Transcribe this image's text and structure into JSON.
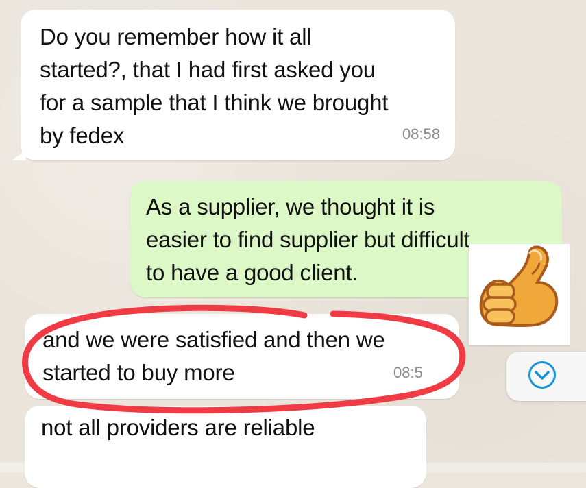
{
  "conversation": {
    "messages": [
      {
        "text": "Do you remember how it all\nstarted?, that I had first asked you\nfor a sample that I think we brought\nby fedex",
        "time": "08:58"
      },
      {
        "text": "As a supplier, we thought it is\neasier to find supplier but difficult\nto have a good client."
      },
      {
        "text": "and we were satisfied and then we\nstarted to buy more",
        "time": "08:5"
      },
      {
        "text": "not all providers are reliable"
      }
    ]
  },
  "icons": {
    "sticker": "thumbs-up-icon",
    "scroll": "chevron-down-icon"
  },
  "colors": {
    "incoming_bubble": "#ffffff",
    "outgoing_bubble": "#dcf8c6",
    "highlight": "#ef3b43",
    "accent": "#1694d8",
    "background": "#ebe5dc"
  }
}
